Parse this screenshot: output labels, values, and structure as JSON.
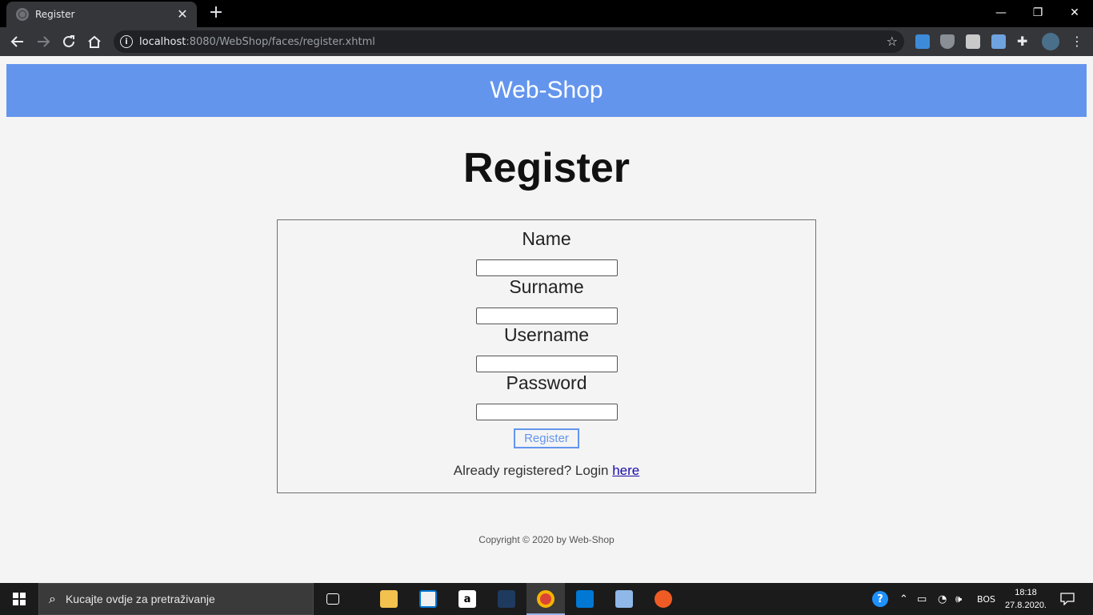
{
  "browser": {
    "tab_title": "Register",
    "tab_close": "✕",
    "new_tab": "+",
    "url_host": "localhost",
    "url_rest": ":8080/WebShop/faces/register.xhtml",
    "window_controls": {
      "minimize": "—",
      "restore": "❐",
      "close": "✕"
    }
  },
  "site": {
    "brand": "Web-Shop",
    "header_color": "#6495ed"
  },
  "form": {
    "title": "Register",
    "fields": [
      {
        "label": "Name",
        "value": ""
      },
      {
        "label": "Surname",
        "value": ""
      },
      {
        "label": "Username",
        "value": ""
      },
      {
        "label": "Password",
        "value": ""
      }
    ],
    "submit_label": "Register",
    "login_prompt": "Already registered? Login",
    "login_link": "here"
  },
  "footer": {
    "copyright": "Copyright © 2020 by Web-Shop"
  },
  "taskbar": {
    "search_placeholder": "Kucajte ovdje za pretraživanje",
    "language": "BOS",
    "time": "18:18",
    "date": "27.8.2020."
  }
}
